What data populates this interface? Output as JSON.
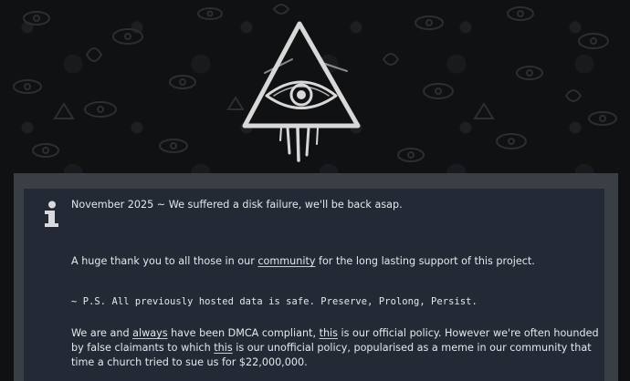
{
  "banner": {
    "logo_icon": "all-seeing-eye-triangle-icon"
  },
  "notice": {
    "icon": "info-icon",
    "status_line": "November 2025 ~ We suffered a disk failure, we'll be back asap.",
    "thanks_before": "A huge thank you to all those in our ",
    "thanks_link": "community",
    "thanks_after": " for the long lasting support of this project.",
    "ps_line": "~ P.S. All previously hosted data is safe. Preserve, Prolong, Persist.",
    "dmca_part1": "We are and ",
    "dmca_always": "always",
    "dmca_part2": " have been DMCA compliant, ",
    "dmca_this1": "this",
    "dmca_part3": " is our official policy. However we're often hounded by false claimants to which ",
    "dmca_this2": "this",
    "dmca_part4": " is our unofficial policy, popularised as a meme in our community that time a church tried to sue us for $22,000,000."
  },
  "colors": {
    "background": "#101113",
    "panel_border": "#3a3e45",
    "panel": "#232a36",
    "text": "#e6e7ea"
  }
}
